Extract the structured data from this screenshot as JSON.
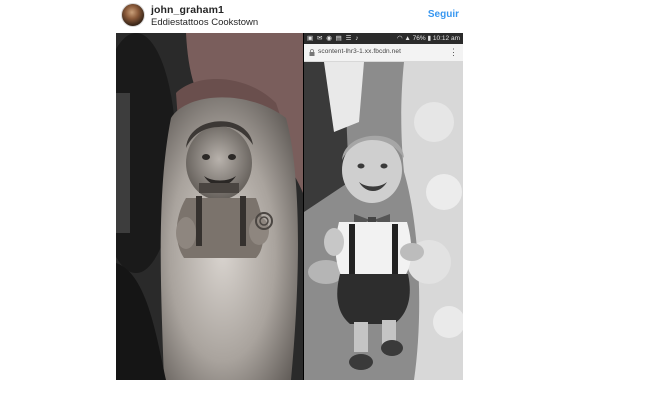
{
  "post": {
    "username": "john_graham1",
    "location": "Eddiestattoos Cookstown",
    "follow_label": "Seguir"
  },
  "phone": {
    "status_time": "10:12 am",
    "battery": "76%",
    "url": "scontent-lhr3-1.xx.fbcdn.net",
    "menu_glyph": "⋮"
  },
  "icons": {
    "lock": "lock-icon",
    "menu": "more-vert-icon",
    "battery": "battery-icon",
    "signal": "signal-icon",
    "wifi": "wifi-icon"
  },
  "colors": {
    "follow": "#3897f0",
    "text": "#262626"
  }
}
